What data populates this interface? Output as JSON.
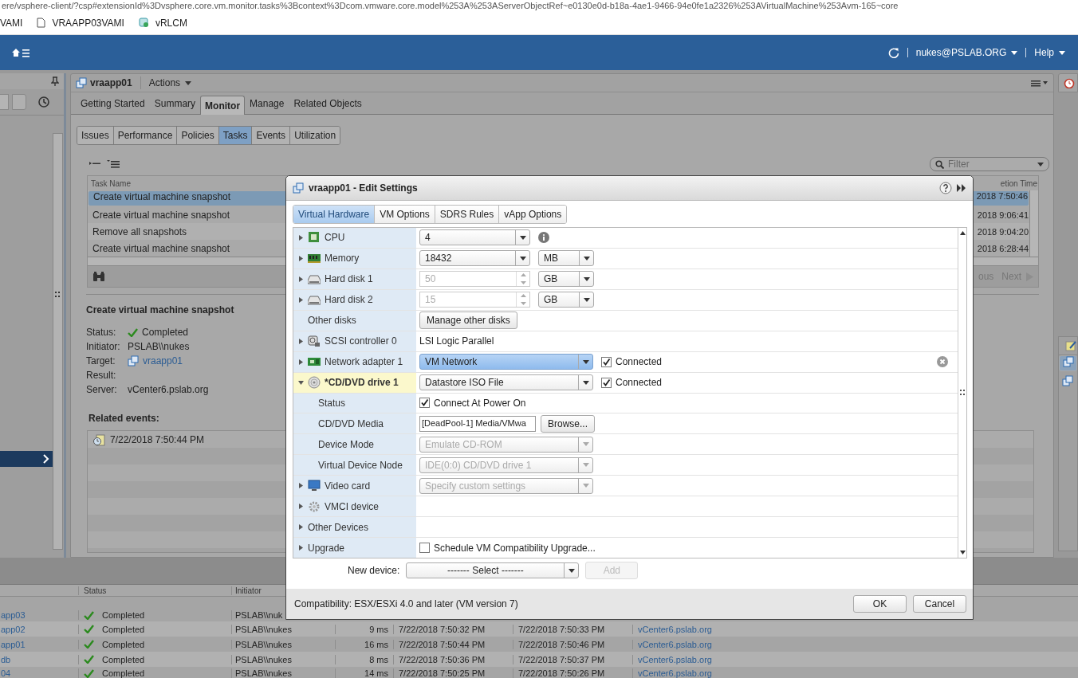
{
  "browser": {
    "address": "ere/vsphere-client/?csp#extensionId%3Dvsphere.core.vm.monitor.tasks%3Bcontext%3Dcom.vmware.core.model%253A%253AServerObjectRef~e0130e0d-b18a-4ae1-9466-94e0fe1a2326%253AVirtualMachine%253Avm-165~core",
    "bookmarks": [
      {
        "label": "VAMI",
        "kind": "none"
      },
      {
        "label": "VRAAPP03VAMI",
        "kind": "page"
      },
      {
        "label": "vRLCM",
        "kind": "app"
      }
    ]
  },
  "header": {
    "user": "nukes@PSLAB.ORG",
    "help": "Help"
  },
  "object": {
    "name": "vraapp01",
    "actions": "Actions",
    "tabs": [
      {
        "label": "Getting Started",
        "selected": false
      },
      {
        "label": "Summary",
        "selected": false
      },
      {
        "label": "Monitor",
        "selected": true
      },
      {
        "label": "Manage",
        "selected": false
      },
      {
        "label": "Related Objects",
        "selected": false
      }
    ]
  },
  "monitor_tabs": [
    {
      "label": "Issues",
      "selected": false
    },
    {
      "label": "Performance",
      "selected": false
    },
    {
      "label": "Policies",
      "selected": false
    },
    {
      "label": "Tasks",
      "selected": true
    },
    {
      "label": "Events",
      "selected": false
    },
    {
      "label": "Utilization",
      "selected": false
    }
  ],
  "filter": {
    "placeholder": "Filter"
  },
  "tasks": {
    "columns": [
      "Task Name",
      "etion Time"
    ],
    "rows": [
      {
        "name": "Create virtual machine snapshot",
        "completion": "2018 7:50:46",
        "selected": true
      },
      {
        "name": "Create virtual machine snapshot",
        "completion": "2018 9:06:41",
        "selected": false
      },
      {
        "name": "Remove all snapshots",
        "completion": "2018 9:04:20",
        "selected": false
      },
      {
        "name": "Create virtual machine snapshot",
        "completion": "2018 6:28:44",
        "selected": false
      }
    ],
    "pager": {
      "previous": "ous",
      "next": "Next"
    }
  },
  "details": {
    "title": "Create virtual machine snapshot",
    "fields": [
      {
        "label": "Status:",
        "value": "Completed",
        "kind": "status"
      },
      {
        "label": "Initiator:",
        "value": "PSLAB\\\\nukes",
        "kind": "text"
      },
      {
        "label": "Target:",
        "value": "vraapp01",
        "kind": "link"
      },
      {
        "label": "Result:"
      },
      {
        "label": "Server:",
        "value": "vCenter6.pslab.org",
        "kind": "text"
      }
    ],
    "events_title": "Related events:",
    "events": [
      "7/22/2018 7:50:44 PM"
    ]
  },
  "recent_tasks": {
    "columns": [
      "Status",
      "Initiator"
    ],
    "rows": [
      {
        "target": "app03",
        "status": "Completed",
        "initiator": "PSLAB\\\\nuk"
      },
      {
        "target": "app02",
        "status": "Completed",
        "initiator": "PSLAB\\\\nukes",
        "duration": "9 ms",
        "start": "7/22/2018 7:50:32 PM",
        "completion": "7/22/2018 7:50:33 PM",
        "server": "vCenter6.pslab.org"
      },
      {
        "target": "app01",
        "status": "Completed",
        "initiator": "PSLAB\\\\nukes",
        "duration": "16 ms",
        "start": "7/22/2018 7:50:44 PM",
        "completion": "7/22/2018 7:50:46 PM",
        "server": "vCenter6.pslab.org"
      },
      {
        "target": "db",
        "status": "Completed",
        "initiator": "PSLAB\\\\nukes",
        "duration": "8 ms",
        "start": "7/22/2018 7:50:36 PM",
        "completion": "7/22/2018 7:50:37 PM",
        "server": "vCenter6.pslab.org"
      },
      {
        "target": "04",
        "status": "Completed",
        "initiator": "PSLAB\\\\nukes",
        "duration": "14 ms",
        "start": "7/22/2018 7:50:25 PM",
        "completion": "7/22/2018 7:50:26 PM",
        "server": "vCenter6.pslab.org"
      }
    ]
  },
  "dialog": {
    "title": "vraapp01 - Edit Settings",
    "tabs": [
      {
        "label": "Virtual Hardware",
        "selected": true
      },
      {
        "label": "VM Options",
        "selected": false
      },
      {
        "label": "SDRS Rules",
        "selected": false
      },
      {
        "label": "vApp Options",
        "selected": false
      }
    ],
    "hardware": [
      {
        "label": "CPU",
        "kind": "cpu",
        "expanded": false,
        "modified": false,
        "controls": [
          {
            "kind": "select",
            "value": "4",
            "disabled": false
          },
          {
            "kind": "info"
          }
        ]
      },
      {
        "label": "Memory",
        "kind": "memory",
        "expanded": false,
        "modified": false,
        "controls": [
          {
            "kind": "select",
            "value": "18432",
            "disabled": false
          },
          {
            "kind": "unit",
            "value": "MB",
            "disabled": false
          }
        ]
      },
      {
        "label": "Hard disk 1",
        "kind": "disk",
        "expanded": false,
        "modified": false,
        "controls": [
          {
            "kind": "spinner",
            "value": "50",
            "disabled": true
          },
          {
            "kind": "unit",
            "value": "GB",
            "disabled": false
          }
        ]
      },
      {
        "label": "Hard disk 2",
        "kind": "disk",
        "expanded": false,
        "modified": false,
        "controls": [
          {
            "kind": "spinner",
            "value": "15",
            "disabled": true
          },
          {
            "kind": "unit",
            "value": "GB",
            "disabled": false
          }
        ]
      },
      {
        "label": "Other disks",
        "modified": false,
        "controls": [
          {
            "kind": "button",
            "label": "Manage other disks"
          }
        ]
      },
      {
        "label": "SCSI controller 0",
        "kind": "scsi",
        "expanded": false,
        "modified": false,
        "controls": [
          {
            "kind": "text",
            "value": "LSI Logic Parallel"
          }
        ]
      },
      {
        "label": "Network adapter 1",
        "kind": "network",
        "expanded": false,
        "modified": false,
        "controls": [
          {
            "kind": "combo",
            "value": "VM Network",
            "disabled": false,
            "focused": true
          },
          {
            "kind": "checkbox",
            "label": "Connected",
            "checked": true
          },
          {
            "kind": "remove"
          }
        ]
      },
      {
        "label": "*CD/DVD drive 1",
        "kind": "cdrom",
        "expanded": true,
        "modified": true,
        "controls": [
          {
            "kind": "combo",
            "value": "Datastore ISO File",
            "disabled": false,
            "focused": false
          },
          {
            "kind": "checkbox",
            "label": "Connected",
            "checked": true
          }
        ],
        "children": [
          {
            "label": "Status",
            "controls": [
              {
                "kind": "checkbox",
                "label": "Connect At Power On",
                "checked": true
              }
            ]
          },
          {
            "label": "CD/DVD Media",
            "controls": [
              {
                "kind": "input",
                "value": "[DeadPool-1] Media/VMwa"
              },
              {
                "kind": "button",
                "label": "Browse..."
              }
            ]
          },
          {
            "label": "Device Mode",
            "controls": [
              {
                "kind": "combo",
                "value": "Emulate CD-ROM",
                "disabled": true,
                "focused": false
              }
            ]
          },
          {
            "label": "Virtual Device Node",
            "controls": [
              {
                "kind": "combo",
                "value": "IDE(0:0) CD/DVD drive 1",
                "disabled": true,
                "focused": false
              }
            ]
          }
        ]
      },
      {
        "label": "Video card",
        "kind": "video",
        "expanded": false,
        "modified": false,
        "controls": [
          {
            "kind": "combo",
            "value": "Specify custom settings",
            "disabled": true,
            "focused": false
          }
        ]
      },
      {
        "label": "VMCI device",
        "kind": "vmci",
        "expanded": false,
        "modified": false
      },
      {
        "label": "Other Devices",
        "expanded": false,
        "modified": false
      },
      {
        "label": "Upgrade",
        "expanded": false,
        "modified": false,
        "controls": [
          {
            "kind": "checkbox",
            "label": "Schedule VM Compatibility Upgrade...",
            "checked": false
          }
        ]
      }
    ],
    "new_device": {
      "label": "New device:",
      "value": "------- Select -------",
      "add": "Add",
      "add_disabled": true
    },
    "compatibility": "Compatibility: ESX/ESXi 4.0 and later (VM version 7)",
    "buttons": [
      "OK",
      "Cancel"
    ]
  }
}
